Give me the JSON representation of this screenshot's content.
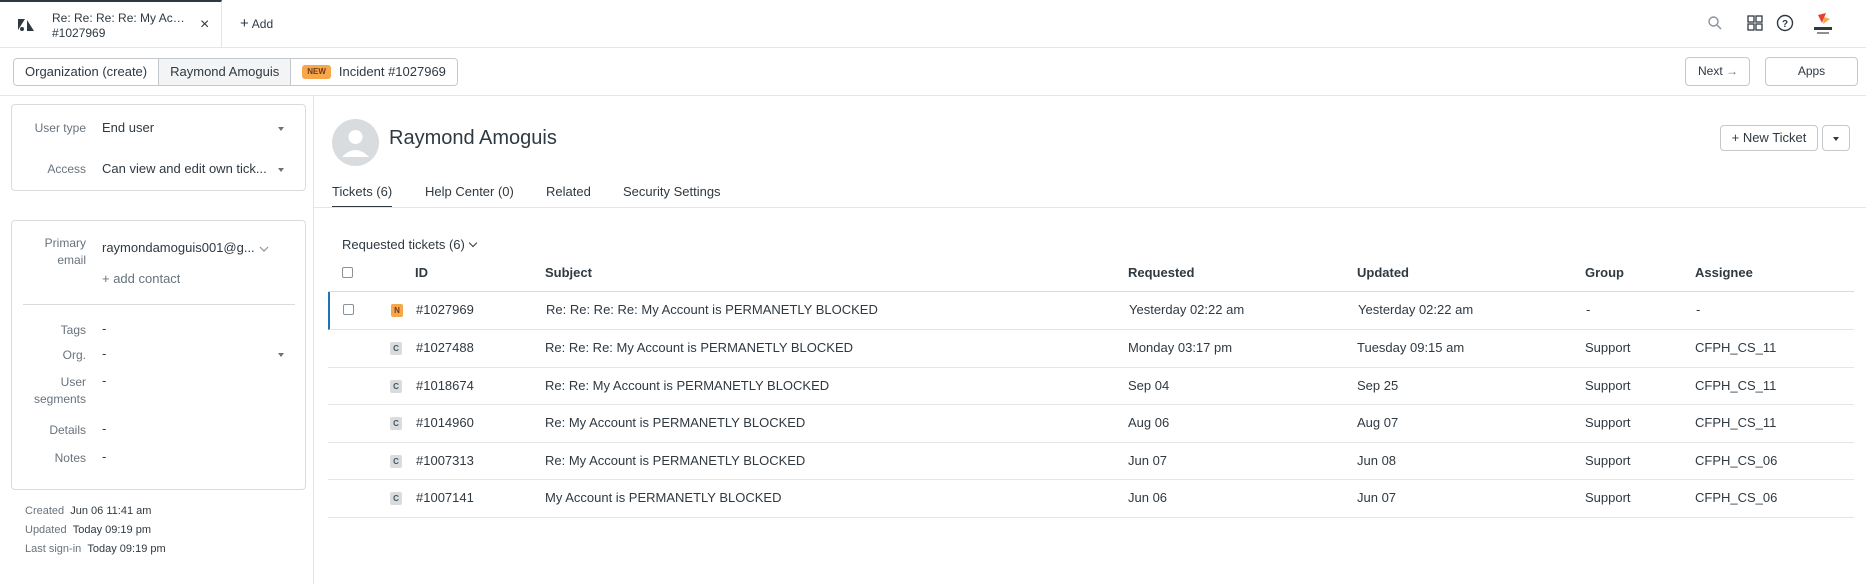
{
  "topbar": {
    "tab_title": "Re: Re: Re: Re: My Accou...",
    "tab_subtitle": "#1027969",
    "add_label": "Add"
  },
  "breadcrumbs": [
    {
      "label": "Organization (create)"
    },
    {
      "label": "Raymond Amoguis"
    },
    {
      "badge": "NEW",
      "label": "Incident #1027969"
    }
  ],
  "nav": {
    "next_label": "Next",
    "apps_label": "Apps"
  },
  "user_fields": {
    "user_type_label": "User type",
    "user_type_value": "End user",
    "access_label": "Access",
    "access_value": "Can view and edit own tick...",
    "primary_email_label_1": "Primary",
    "primary_email_label_2": "email",
    "primary_email_value": "raymondamoguis001@g...",
    "add_contact": "+ add contact",
    "tags_label": "Tags",
    "tags_value": "-",
    "org_label": "Org.",
    "org_value": "-",
    "segments_label_1": "User",
    "segments_label_2": "segments",
    "segments_value": "-",
    "details_label": "Details",
    "details_value": "-",
    "notes_label": "Notes",
    "notes_value": "-"
  },
  "meta": {
    "created_label": "Created",
    "created_value": "Jun 06 11:41 am",
    "updated_label": "Updated",
    "updated_value": "Today 09:19 pm",
    "last_signin_label": "Last sign-in",
    "last_signin_value": "Today 09:19 pm"
  },
  "profile": {
    "name": "Raymond Amoguis",
    "new_ticket_label": "+ New Ticket"
  },
  "profile_tabs": [
    {
      "label": "Tickets (6)"
    },
    {
      "label": "Help Center (0)"
    },
    {
      "label": "Related"
    },
    {
      "label": "Security Settings"
    }
  ],
  "tickets": {
    "section_title": "Requested tickets (6)",
    "columns": {
      "id": "ID",
      "subject": "Subject",
      "requested": "Requested",
      "updated": "Updated",
      "group": "Group",
      "assignee": "Assignee"
    },
    "rows": [
      {
        "status": "N",
        "id": "#1027969",
        "subject": "Re: Re: Re: Re: My Account is PERMANETLY BLOCKED",
        "requested": "Yesterday 02:22 am",
        "updated": "Yesterday 02:22 am",
        "group": "-",
        "assignee": "-"
      },
      {
        "status": "C",
        "id": "#1027488",
        "subject": "Re: Re: Re: My Account is PERMANETLY BLOCKED",
        "requested": "Monday 03:17 pm",
        "updated": "Tuesday 09:15 am",
        "group": "Support",
        "assignee": "CFPH_CS_11"
      },
      {
        "status": "C",
        "id": "#1018674",
        "subject": "Re: Re: My Account is PERMANETLY BLOCKED",
        "requested": "Sep 04",
        "updated": "Sep 25",
        "group": "Support",
        "assignee": "CFPH_CS_11"
      },
      {
        "status": "C",
        "id": "#1014960",
        "subject": "Re: My Account is PERMANETLY BLOCKED",
        "requested": "Aug 06",
        "updated": "Aug 07",
        "group": "Support",
        "assignee": "CFPH_CS_11"
      },
      {
        "status": "C",
        "id": "#1007313",
        "subject": "Re: My Account is PERMANETLY BLOCKED",
        "requested": "Jun 07",
        "updated": "Jun 08",
        "group": "Support",
        "assignee": "CFPH_CS_06"
      },
      {
        "status": "C",
        "id": "#1007141",
        "subject": "My Account is PERMANETLY BLOCKED",
        "requested": "Jun 06",
        "updated": "Jun 07",
        "group": "Support",
        "assignee": "CFPH_CS_06"
      }
    ]
  },
  "colors": {
    "accent": "#1f73b7",
    "new_badge": "#f7a64a",
    "closed_badge": "#d8dcde",
    "text": "#2f3941"
  }
}
